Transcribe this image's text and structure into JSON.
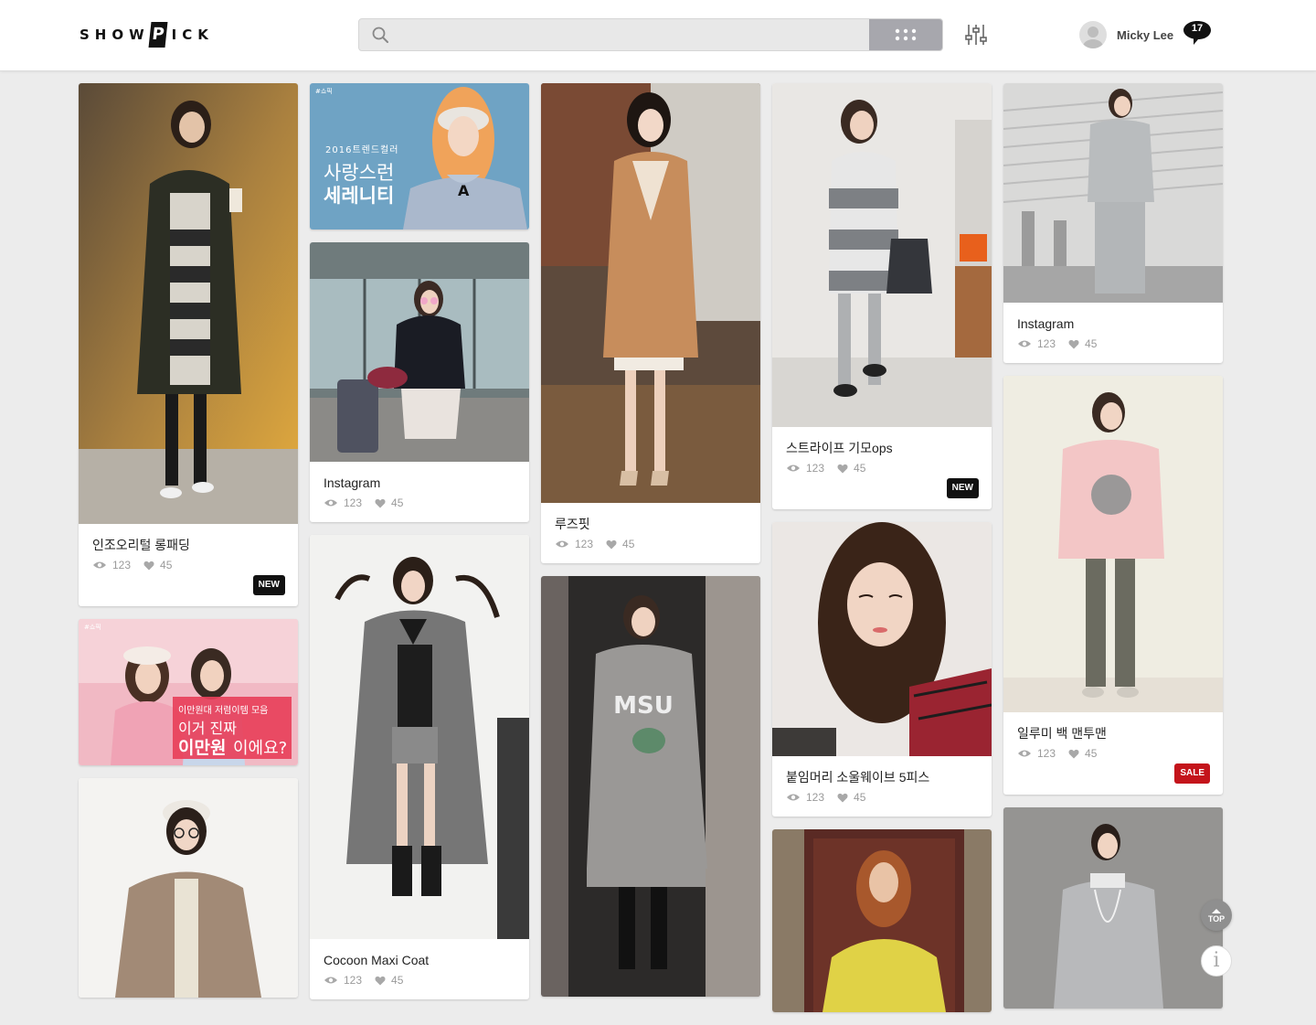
{
  "brand": {
    "logo_pre": "SHOW",
    "logo_box": "P",
    "logo_post": "ICK"
  },
  "search": {
    "placeholder": "",
    "value": ""
  },
  "user": {
    "name": "Micky Lee",
    "notifications": "17"
  },
  "stats": {
    "views": "123",
    "likes": "45"
  },
  "columns": [
    [
      {
        "title": "인조오리털 롱패딩",
        "badge": "NEW",
        "badge_type": "new",
        "has_info": true
      },
      {
        "banner": {
          "tag": "#쇼픽",
          "line1": "이만원대 저렴이템 모음",
          "line2": "이거 진짜",
          "line3a": "이만원",
          "line3b": "이에요?"
        },
        "has_info": false
      },
      {
        "has_info": false
      }
    ],
    [
      {
        "banner": {
          "tag": "#쇼픽",
          "line1": "2016트렌드컬러",
          "line2": "사랑스런",
          "line3": "세레니티"
        },
        "has_info": false
      },
      {
        "title": "Instagram",
        "has_info": true
      },
      {
        "title": "Cocoon Maxi Coat",
        "has_info": true
      }
    ],
    [
      {
        "title": "루즈핏",
        "has_info": true
      },
      {
        "has_info": false
      }
    ],
    [
      {
        "title": "스트라이프 기모ops",
        "badge": "NEW",
        "badge_type": "new",
        "has_info": true
      },
      {
        "title": "붙임머리 소울웨이브 5피스",
        "has_info": true
      },
      {
        "has_info": false
      }
    ],
    [
      {
        "title": "Instagram",
        "has_info": true
      },
      {
        "title": "일루미 백 맨투맨",
        "badge": "SALE",
        "badge_type": "sale",
        "has_info": true
      },
      {
        "has_info": false
      }
    ]
  ],
  "photo_print": {
    "shirt": "MSU",
    "sweater_letter": "A"
  },
  "buttons": {
    "top": "TOP",
    "info": "i"
  },
  "colors": {
    "header_bg": "#ffffff",
    "page_bg": "#ececec",
    "new_badge": "#111111",
    "sale_badge": "#c4141b",
    "banner_pink": "#e8405a",
    "search_btn": "#a7a7ad"
  }
}
